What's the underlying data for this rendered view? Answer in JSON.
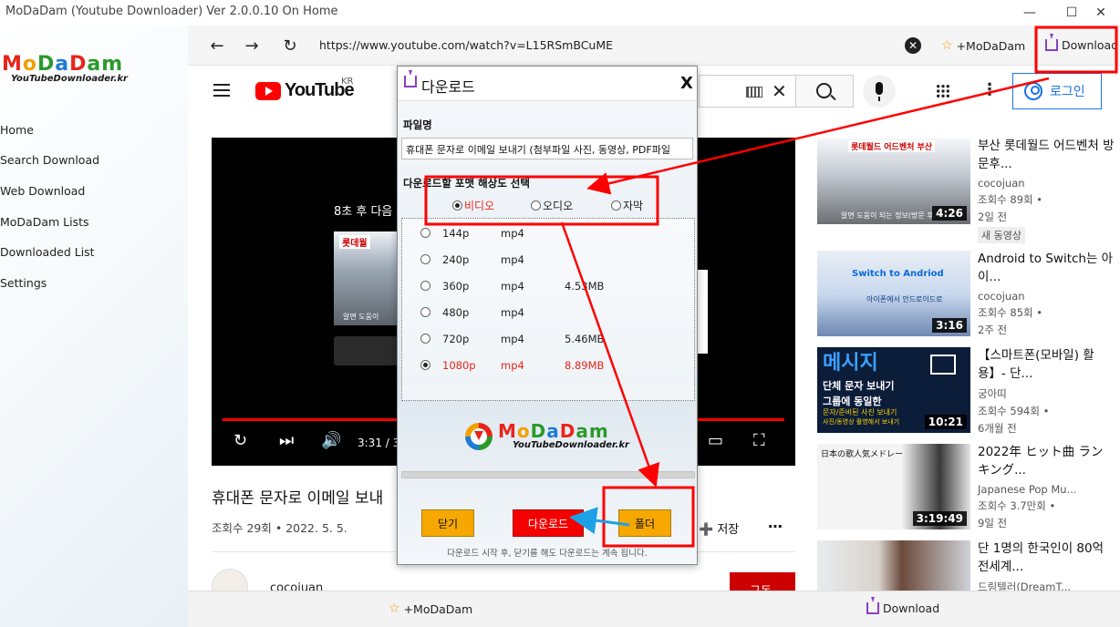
{
  "window": {
    "title": "MoDaDam (Youtube Downloader) Ver 2.0.0.10 On Home"
  },
  "sidebar": {
    "logo_text": "MoDaDam",
    "logo_sub": "YouTubeDownloader.kr",
    "items": [
      {
        "label": "Home"
      },
      {
        "label": "Search Download"
      },
      {
        "label": "Web Download"
      },
      {
        "label": "MoDaDam Lists"
      },
      {
        "label": "Downloaded List"
      },
      {
        "label": "Settings"
      }
    ]
  },
  "toolbar": {
    "url": "https://www.youtube.com/watch?v=L15RSmBCuME",
    "modadam_label": "+MoDaDam",
    "download_label": "Download"
  },
  "youtube": {
    "logo_word": "YouTube",
    "region": "KR",
    "login_label": "로그인",
    "next_up_text": "8초 후 다음",
    "next_thumb_caption": "롯데월",
    "next_thumb_label": "알면 도움이",
    "player_time": "3:31 / 3",
    "video_title": "휴대폰 문자로 이메일 보내",
    "video_title_tail": ")",
    "video_meta": "조회수 29회 • 2022. 5. 5.",
    "save_label": "저장",
    "channel_name": "cocojuan",
    "subscribe_label": "구독"
  },
  "recommendations": [
    {
      "thumb_caption": "롯데월드 어드벤처 부산",
      "thumb_sub": "알면 도움이 되는 정보(방문 후기,",
      "duration": "4:26",
      "title": "부산 롯데월드 어드벤처 방문후...",
      "channel": "cocojuan",
      "views": "조회수 89회 •",
      "age": "2일 전",
      "badge": "새 동영상"
    },
    {
      "thumb_caption": "Switch to Andriod",
      "thumb_sub": "아이폰에서 안드로이드로",
      "duration": "3:16",
      "title": "Android to Switch는 아이...",
      "channel": "cocojuan",
      "views": "조회수 85회 •",
      "age": "2주 전"
    },
    {
      "thumb_caption": "메시지",
      "thumb_sub": "단체 문자 보내기",
      "thumb_sub2": "그룹에 동일한",
      "thumb_sub3": "문자/준비된 사진 보내기",
      "thumb_sub4": "사진/동영상 촬영해서 보내기",
      "duration": "10:21",
      "title": "【스마트폰(모바일) 활용】- 단...",
      "channel": "궁아띠",
      "views": "조회수 594회 •",
      "age": "6개월 전"
    },
    {
      "thumb_caption": "日本の歌人気メドレー",
      "duration": "3:19:49",
      "title": "2022年 ヒット曲 ランキング...",
      "channel": "Japanese Pop Mu...",
      "views": "조회수 3.7만회 •",
      "age": "9일 전"
    },
    {
      "title": "단 1명의 한국인이 80억 전세계...",
      "channel": "드림텔러(DreamT..."
    }
  ],
  "bottombar": {
    "modadam_label": "+MoDaDam",
    "download_label": "Download"
  },
  "dialog": {
    "title": "다운로드",
    "close_glyph": "X",
    "filename_label": "파일명",
    "filename_value": "휴대폰 문자로 이메일 보내기 (첨부파일 사진, 동영상, PDF파일",
    "format_label": "다운로드할 포맷 해상도 선택",
    "types": [
      {
        "label": "비디오",
        "selected": true
      },
      {
        "label": "오디오",
        "selected": false
      },
      {
        "label": "자막",
        "selected": false
      }
    ],
    "formats": [
      {
        "res": "144p",
        "ext": "mp4",
        "size": "",
        "selected": false
      },
      {
        "res": "240p",
        "ext": "mp4",
        "size": "",
        "selected": false
      },
      {
        "res": "360p",
        "ext": "mp4",
        "size": "4.53MB",
        "selected": false
      },
      {
        "res": "480p",
        "ext": "mp4",
        "size": "",
        "selected": false
      },
      {
        "res": "720p",
        "ext": "mp4",
        "size": "5.46MB",
        "selected": false
      },
      {
        "res": "1080p",
        "ext": "mp4",
        "size": "8.89MB",
        "selected": true
      }
    ],
    "logo_text": "MoDaDam",
    "logo_sub": "YouTubeDownloader.kr",
    "close_button": "닫기",
    "download_button": "다운로드",
    "folder_button": "폴더",
    "note": "다운로드 시작 후, 닫기를 해도 다운로드는 계속 됩니다."
  },
  "colors": {
    "accent_red": "#e8241a",
    "annotation_red": "#ff0000",
    "annotation_blue": "#1ea0e6",
    "button_orange": "#f6a800",
    "download_purple": "#8a3fc4",
    "youtube_red": "#ff0000",
    "login_blue": "#1a73e8"
  }
}
